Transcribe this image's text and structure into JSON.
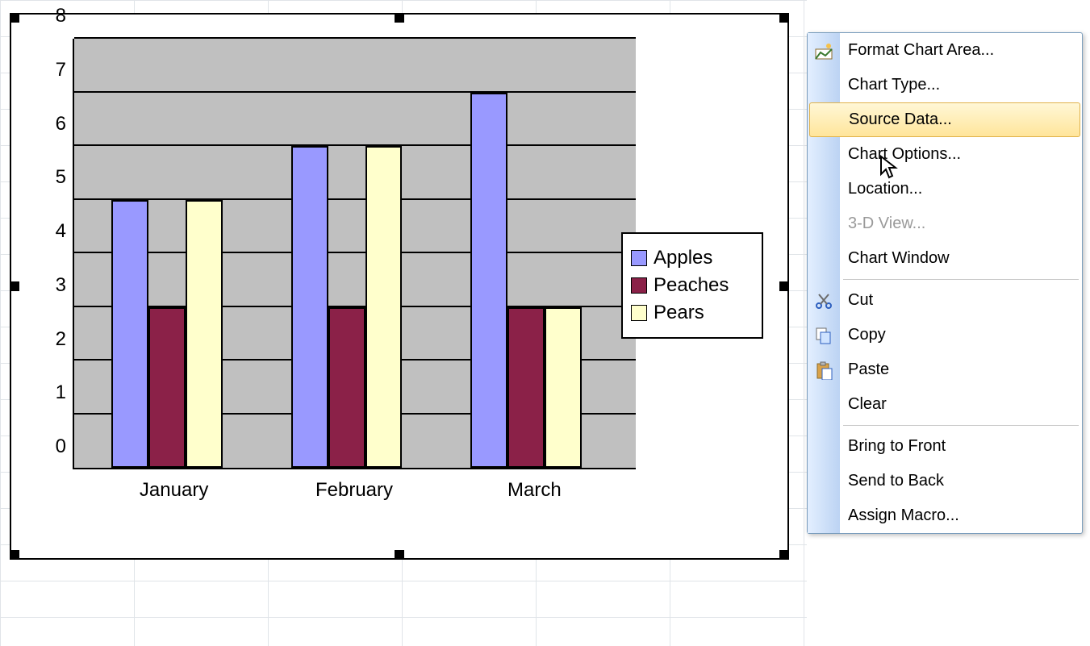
{
  "chart_data": {
    "type": "bar",
    "categories": [
      "January",
      "February",
      "March"
    ],
    "series": [
      {
        "name": "Apples",
        "values": [
          5,
          6,
          7
        ],
        "color": "#9999ff"
      },
      {
        "name": "Peaches",
        "values": [
          3,
          3,
          3
        ],
        "color": "#8b2148"
      },
      {
        "name": "Pears",
        "values": [
          5,
          6,
          3
        ],
        "color": "#ffffcc"
      }
    ],
    "y_ticks": [
      0,
      1,
      2,
      3,
      4,
      5,
      6,
      7,
      8
    ],
    "ylim": [
      0,
      8
    ],
    "xlabel": "",
    "ylabel": "",
    "title": ""
  },
  "legend": {
    "items": [
      "Apples",
      "Peaches",
      "Pears"
    ]
  },
  "context_menu": {
    "items": [
      {
        "label": "Format Chart Area...",
        "icon": "format-chart-area-icon",
        "enabled": true
      },
      {
        "label": "Chart Type...",
        "enabled": true
      },
      {
        "label": "Source Data...",
        "enabled": true,
        "hover": true
      },
      {
        "label": "Chart Options...",
        "enabled": true
      },
      {
        "label": "Location...",
        "enabled": true
      },
      {
        "label": "3-D View...",
        "enabled": false
      },
      {
        "label": "Chart Window",
        "enabled": true
      },
      {
        "sep": true
      },
      {
        "label": "Cut",
        "icon": "cut-icon",
        "enabled": true
      },
      {
        "label": "Copy",
        "icon": "copy-icon",
        "enabled": true
      },
      {
        "label": "Paste",
        "icon": "paste-icon",
        "enabled": true
      },
      {
        "label": "Clear",
        "enabled": true
      },
      {
        "sep": true
      },
      {
        "label": "Bring to Front",
        "enabled": true
      },
      {
        "label": "Send to Back",
        "enabled": true
      },
      {
        "label": "Assign Macro...",
        "enabled": true
      }
    ]
  }
}
